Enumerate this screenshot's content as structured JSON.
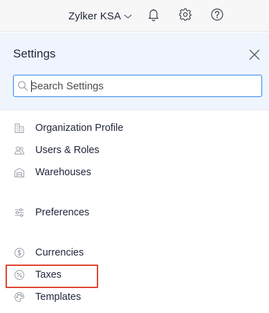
{
  "topbar": {
    "org_name": "Zylker KSA",
    "icons": [
      "chevron-down-icon",
      "bell-icon",
      "gear-icon",
      "help-icon"
    ]
  },
  "panel": {
    "title": "Settings",
    "search_placeholder": "Search Settings"
  },
  "menu": {
    "items": [
      {
        "label": "Organization Profile",
        "icon": "building-icon"
      },
      {
        "label": "Users & Roles",
        "icon": "users-icon"
      },
      {
        "label": "Warehouses",
        "icon": "warehouse-icon"
      },
      {
        "label": "Preferences",
        "icon": "sliders-icon"
      },
      {
        "label": "Currencies",
        "icon": "currency-icon"
      },
      {
        "label": "Taxes",
        "icon": "percent-icon"
      },
      {
        "label": "Templates",
        "icon": "palette-icon"
      }
    ],
    "highlighted_item": "Taxes"
  },
  "colors": {
    "header_bg": "#f0f5fd",
    "accent": "#3b8ff2",
    "highlight": "#e0432f",
    "icon": "#9a9ea8"
  }
}
